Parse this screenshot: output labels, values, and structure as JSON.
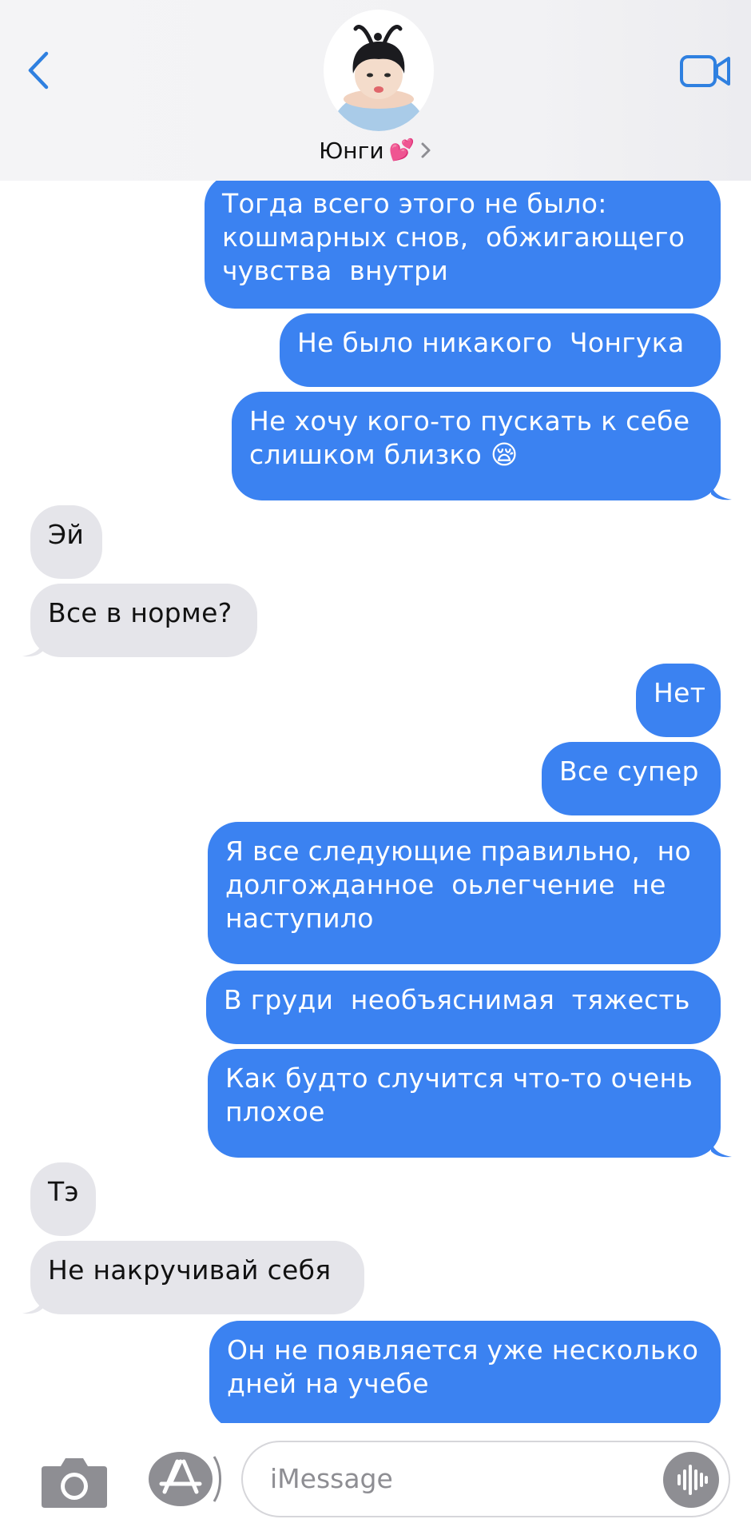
{
  "header": {
    "contact_name": "Юнги",
    "contact_emoji": "💕"
  },
  "icons": {
    "back": "chevron-left-icon",
    "video": "video-camera-icon",
    "detail": "chevron-right-icon",
    "camera": "camera-icon",
    "apps": "app-store-icon",
    "voice": "waveform-icon"
  },
  "colors": {
    "outgoing_bubble": "#3b82f1",
    "incoming_bubble": "#e5e5ea",
    "accent": "#2f80e0"
  },
  "messages": [
    {
      "from": "me",
      "text": "Тогда всего этого не было:\nкошмарных снов,  обжигающего\nчувства  внутри"
    },
    {
      "from": "me",
      "text": "Не было никакого  Чонгука"
    },
    {
      "from": "me",
      "text": "Не хочу кого-то пускать к себе\nслишком близко 😪"
    },
    {
      "from": "them",
      "text": "Эй"
    },
    {
      "from": "them",
      "text": "Все в норме?"
    },
    {
      "from": "me",
      "text": "Нет"
    },
    {
      "from": "me",
      "text": "Все супер"
    },
    {
      "from": "me",
      "text": "Я все следующие правильно,  но\nдолгожданное  оьлегчение  не\nнаступило"
    },
    {
      "from": "me",
      "text": "В груди  необъяснимая  тяжесть"
    },
    {
      "from": "me",
      "text": "Как будто случится что-то очень\nплохое"
    },
    {
      "from": "them",
      "text": "Тэ"
    },
    {
      "from": "them",
      "text": "Не накручивай себя"
    },
    {
      "from": "me",
      "text": "Он не появляется уже несколько\nдней на учебе"
    }
  ],
  "input": {
    "placeholder": "iMessage"
  }
}
